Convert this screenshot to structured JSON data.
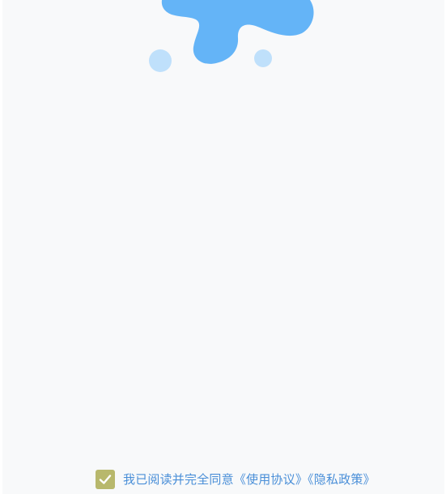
{
  "colors": {
    "background": "#f8f9fa",
    "splash_blue": "#64b4f7",
    "splash_dot": "#bfe0fb",
    "checkbox_fill": "#b8b86c",
    "link_text": "#4a8fd8"
  },
  "splash": {
    "icon": "paint-splash-icon"
  },
  "agreement": {
    "checked": true,
    "checkbox_icon": "checkmark-icon",
    "prefix": "我已阅读并完全同意",
    "terms_link": "《使用协议》",
    "privacy_link": "《隐私政策》"
  }
}
